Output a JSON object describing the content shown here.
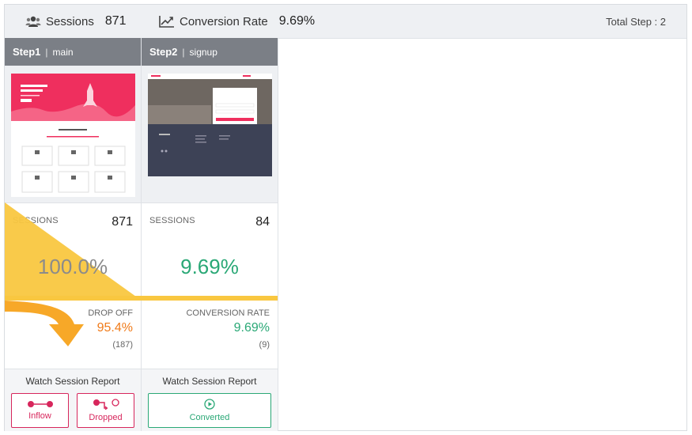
{
  "topbar": {
    "sessions_label": "Sessions",
    "sessions_value": "871",
    "conversion_label": "Conversion Rate",
    "conversion_value": "9.69%",
    "total_step": "Total Step : 2"
  },
  "steps": [
    {
      "step_label": "Step1",
      "page_name": "main",
      "sessions_label": "SESSIONS",
      "sessions_value": "871",
      "percent": "100.0%",
      "metric_label": "DROP OFF",
      "metric_value": "95.4%",
      "metric_count": "(187)",
      "report_title": "Watch Session Report",
      "buttons": [
        "Inflow",
        "Dropped"
      ]
    },
    {
      "step_label": "Step2",
      "page_name": "signup",
      "sessions_label": "SESSIONS",
      "sessions_value": "84",
      "percent": "9.69%",
      "metric_label": "CONVERSION RATE",
      "metric_value": "9.69%",
      "metric_count": "(9)",
      "report_title": "Watch Session Report",
      "buttons": [
        "Converted"
      ]
    }
  ],
  "colors": {
    "drop": "#f07b1a",
    "conversion": "#2aa876",
    "accent_red": "#d7265c",
    "funnel": "#f9c740"
  }
}
